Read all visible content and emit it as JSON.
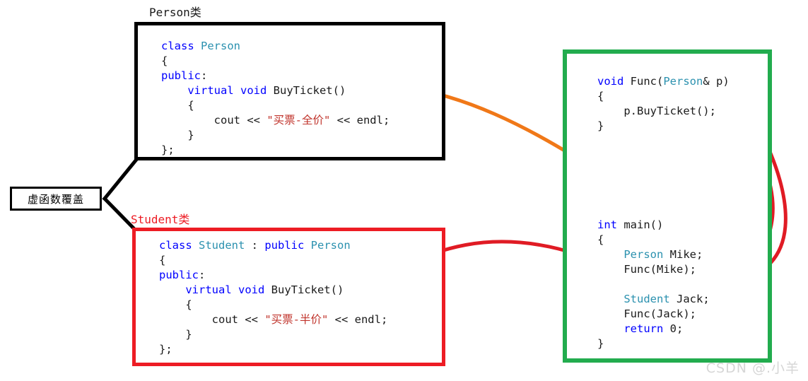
{
  "diagram": {
    "title_label": "虚函数覆盖",
    "captions": {
      "person": "Person类",
      "student": "Student类"
    },
    "watermark": "CSDN @.小羊",
    "colors": {
      "person_box_border": "#000000",
      "student_box_border": "#ED1C24",
      "main_box_border": "#22AC4E",
      "keyword": "#0000FF",
      "type": "#2B91AF",
      "string_literal": "#C0332B",
      "arrow_orange": "#F07818",
      "arrow_red": "#E01B24",
      "connector_black": "#000000"
    }
  },
  "person_class": {
    "lines": [
      {
        "segments": [
          {
            "t": "class ",
            "c": "kw"
          },
          {
            "t": "Person",
            "c": "type"
          }
        ]
      },
      {
        "segments": [
          {
            "t": "{",
            "c": "plain"
          }
        ]
      },
      {
        "segments": [
          {
            "t": "public",
            "c": "kw"
          },
          {
            "t": ":",
            "c": "plain"
          }
        ]
      },
      {
        "segments": [
          {
            "t": "    ",
            "c": "plain"
          },
          {
            "t": "virtual void ",
            "c": "kw"
          },
          {
            "t": "BuyTicket()",
            "c": "plain"
          }
        ]
      },
      {
        "segments": [
          {
            "t": "    {",
            "c": "plain"
          }
        ]
      },
      {
        "segments": [
          {
            "t": "        cout << ",
            "c": "plain"
          },
          {
            "t": "\"买票-全价\"",
            "c": "str"
          },
          {
            "t": " << endl;",
            "c": "plain"
          }
        ]
      },
      {
        "segments": [
          {
            "t": "    }",
            "c": "plain"
          }
        ]
      },
      {
        "segments": [
          {
            "t": "};",
            "c": "plain"
          }
        ]
      }
    ]
  },
  "student_class": {
    "lines": [
      {
        "segments": [
          {
            "t": "class ",
            "c": "kw"
          },
          {
            "t": "Student",
            "c": "type"
          },
          {
            "t": " : ",
            "c": "plain"
          },
          {
            "t": "public ",
            "c": "kw"
          },
          {
            "t": "Person",
            "c": "type"
          }
        ]
      },
      {
        "segments": [
          {
            "t": "{",
            "c": "plain"
          }
        ]
      },
      {
        "segments": [
          {
            "t": "public",
            "c": "kw"
          },
          {
            "t": ":",
            "c": "plain"
          }
        ]
      },
      {
        "segments": [
          {
            "t": "    ",
            "c": "plain"
          },
          {
            "t": "virtual void ",
            "c": "kw"
          },
          {
            "t": "BuyTicket()",
            "c": "plain"
          }
        ]
      },
      {
        "segments": [
          {
            "t": "    {",
            "c": "plain"
          }
        ]
      },
      {
        "segments": [
          {
            "t": "        cout << ",
            "c": "plain"
          },
          {
            "t": "\"买票-半价\"",
            "c": "str"
          },
          {
            "t": " << endl;",
            "c": "plain"
          }
        ]
      },
      {
        "segments": [
          {
            "t": "    }",
            "c": "plain"
          }
        ]
      },
      {
        "segments": [
          {
            "t": "};",
            "c": "plain"
          }
        ]
      }
    ]
  },
  "func_block": {
    "lines": [
      {
        "segments": [
          {
            "t": "void ",
            "c": "kw"
          },
          {
            "t": "Func(",
            "c": "plain"
          },
          {
            "t": "Person",
            "c": "type"
          },
          {
            "t": "& p)",
            "c": "plain"
          }
        ]
      },
      {
        "segments": [
          {
            "t": "{",
            "c": "plain"
          }
        ]
      },
      {
        "segments": [
          {
            "t": "    p.BuyTicket();",
            "c": "plain"
          }
        ]
      },
      {
        "segments": [
          {
            "t": "}",
            "c": "plain"
          }
        ]
      }
    ]
  },
  "main_block": {
    "lines": [
      {
        "segments": [
          {
            "t": "int ",
            "c": "kw"
          },
          {
            "t": "main()",
            "c": "plain"
          }
        ]
      },
      {
        "segments": [
          {
            "t": "{",
            "c": "plain"
          }
        ]
      },
      {
        "segments": [
          {
            "t": "    ",
            "c": "plain"
          },
          {
            "t": "Person",
            "c": "type"
          },
          {
            "t": " Mike;",
            "c": "plain"
          }
        ]
      },
      {
        "segments": [
          {
            "t": "    Func(Mike);",
            "c": "plain"
          }
        ]
      },
      {
        "segments": [
          {
            "t": "",
            "c": "plain"
          }
        ]
      },
      {
        "segments": [
          {
            "t": "    ",
            "c": "plain"
          },
          {
            "t": "Student",
            "c": "type"
          },
          {
            "t": " Jack;",
            "c": "plain"
          }
        ]
      },
      {
        "segments": [
          {
            "t": "    Func(Jack);",
            "c": "plain"
          }
        ]
      },
      {
        "segments": [
          {
            "t": "    ",
            "c": "plain"
          },
          {
            "t": "return ",
            "c": "kw"
          },
          {
            "t": "0;",
            "c": "plain"
          }
        ]
      },
      {
        "segments": [
          {
            "t": "}",
            "c": "plain"
          }
        ]
      }
    ]
  }
}
